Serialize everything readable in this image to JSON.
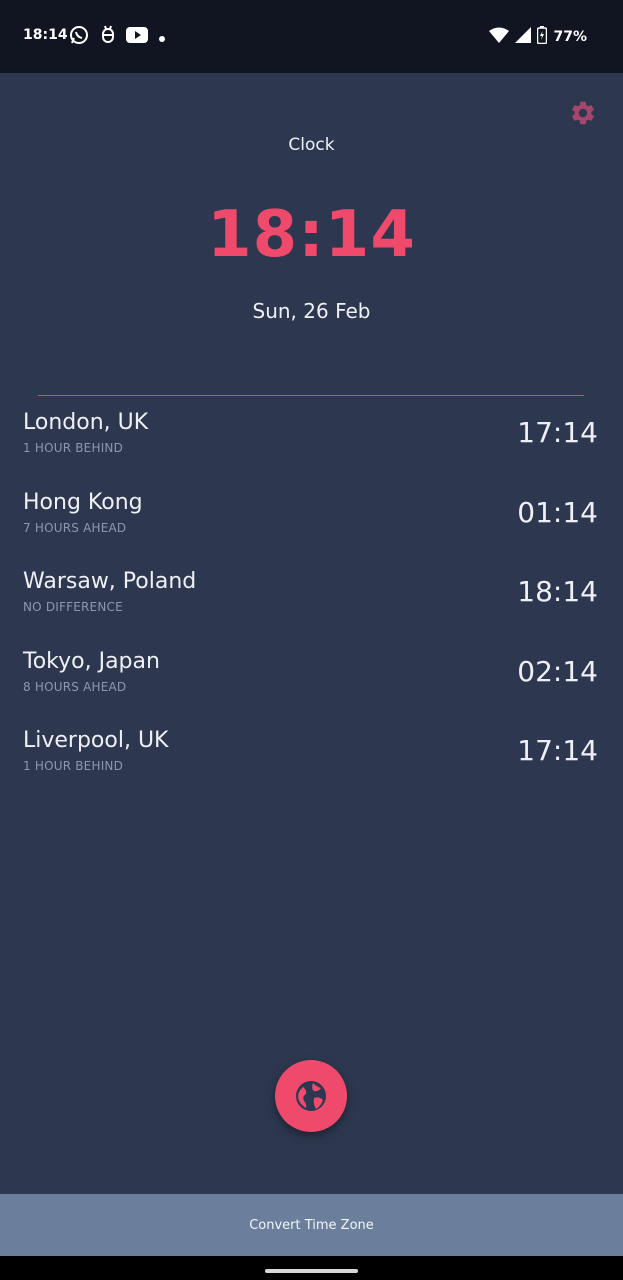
{
  "status_bar": {
    "time": "18:14",
    "battery": "77%",
    "notification_icons": [
      "whatsapp-icon",
      "bug-notification-icon",
      "youtube-icon",
      "dot-icon"
    ],
    "system_icons": [
      "wifi-icon",
      "signal-icon",
      "battery-icon"
    ]
  },
  "header": {
    "title": "Clock",
    "settings_icon": "gear-icon"
  },
  "clock": {
    "time": "18:14",
    "date": "Sun, 26 Feb"
  },
  "zones": [
    {
      "city": "London, UK",
      "diff": "1 HOUR BEHIND",
      "time": "17:14"
    },
    {
      "city": "Hong Kong",
      "diff": "7 HOURS AHEAD",
      "time": "01:14"
    },
    {
      "city": "Warsaw, Poland",
      "diff": "NO DIFFERENCE",
      "time": "18:14"
    },
    {
      "city": "Tokyo, Japan",
      "diff": "8 HOURS AHEAD",
      "time": "02:14"
    },
    {
      "city": "Liverpool, UK",
      "diff": "1 HOUR BEHIND",
      "time": "17:14"
    }
  ],
  "fab": {
    "icon": "globe-icon"
  },
  "footer": {
    "convert_label": "Convert Time Zone"
  },
  "colors": {
    "background": "#2d3850",
    "accent": "#ef4a6b",
    "footer_bar": "#6b7f9c",
    "status_bar": "#101521"
  }
}
